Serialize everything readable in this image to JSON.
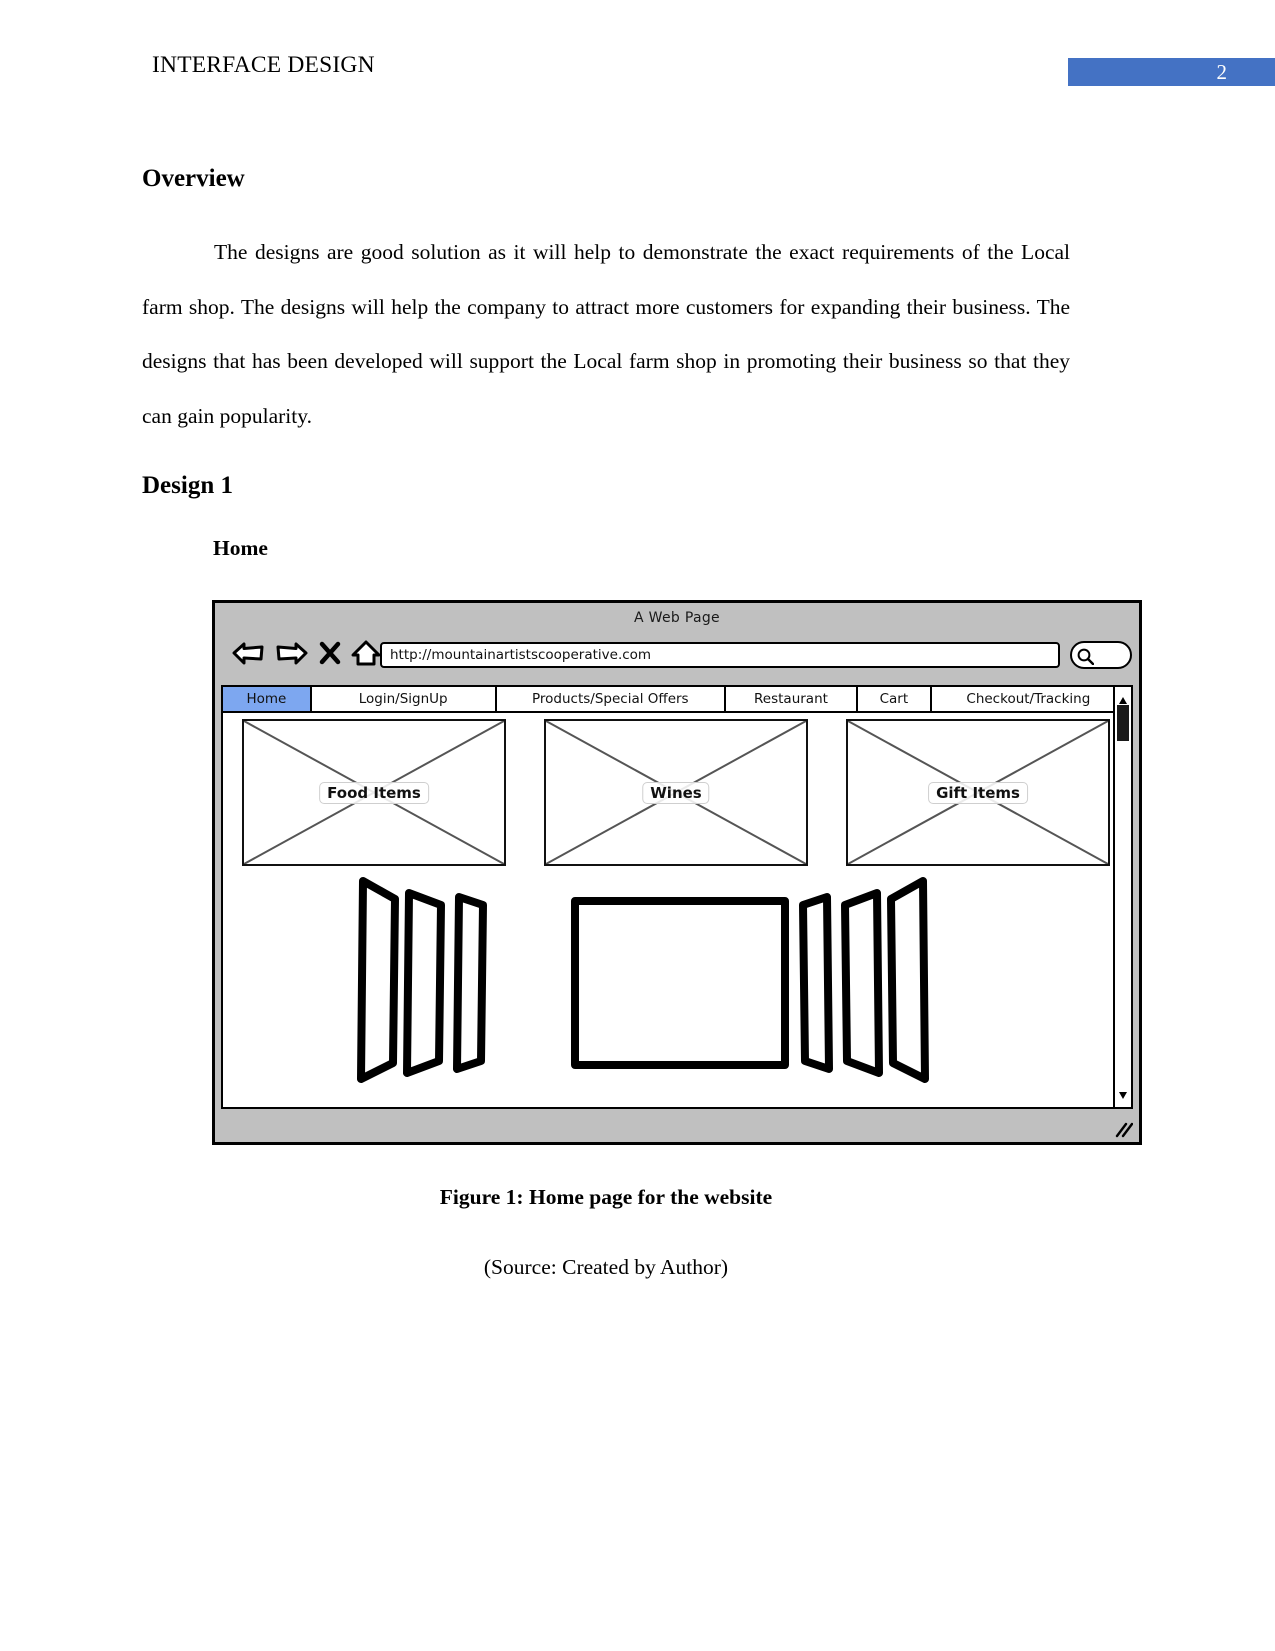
{
  "header": {
    "title": "INTERFACE DESIGN",
    "page_number": "2",
    "badge_color": "#4472c4"
  },
  "document": {
    "overview_heading": "Overview",
    "overview_paragraph": "The designs are good solution as it will help to demonstrate the exact requirements of the Local farm shop. The designs will help the company to attract more customers for expanding their business. The designs that has been developed will support the Local farm shop in promoting their business so that they can gain popularity.",
    "design_heading": "Design 1",
    "home_subheading": "Home",
    "figure_caption": "Figure 1: Home page for the website",
    "figure_source": "(Source: Created by Author)"
  },
  "mockup": {
    "window_title": "A Web Page",
    "url": "http://mountainartistscooperative.com",
    "toolbar_icons": [
      "back-arrow-icon",
      "forward-arrow-icon",
      "stop-x-icon",
      "home-icon"
    ],
    "search_icon": "magnifier-icon",
    "nav_tabs": [
      {
        "label": "Home",
        "active": true
      },
      {
        "label": "Login/SignUp",
        "active": false
      },
      {
        "label": "Products/Special Offers",
        "active": false
      },
      {
        "label": "Restaurant",
        "active": false
      },
      {
        "label": "Cart",
        "active": false
      },
      {
        "label": "Checkout/Tracking",
        "active": false
      }
    ],
    "thumbnails": [
      {
        "label": "Food Items"
      },
      {
        "label": "Wines"
      },
      {
        "label": "Gift Items"
      }
    ],
    "active_tab_color": "#7da7f0",
    "chrome_color": "#c0c0c0"
  }
}
